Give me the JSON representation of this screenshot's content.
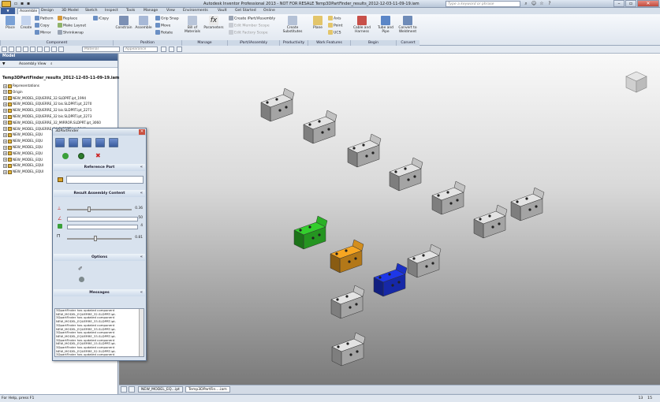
{
  "window": {
    "title": "Autodesk Inventor Professional 2013 - NOT FOR RESALE    Temp3DPartFinder_results_2012-12-03-11-09-19.iam",
    "search_placeholder": "Type a keyword or phrase"
  },
  "tabs": [
    "Assemble",
    "Design",
    "3D Model",
    "Sketch",
    "Inspect",
    "Tools",
    "Manage",
    "View",
    "Environments",
    "Vault",
    "Get Started",
    "Online"
  ],
  "ribbon": {
    "place": "Place",
    "create": "Create",
    "pattern": "Pattern",
    "copy": "Copy",
    "mirror": "Mirror",
    "replace": "Replace",
    "make_layout": "Make Layout",
    "shrinkwrap": "Shrinkwrap",
    "icopy": "iCopy",
    "constrain": "Constrain",
    "assemble": "Assemble",
    "grip_snap": "Grip Snap",
    "move": "Move",
    "rotate": "Rotate",
    "bill_of_materials": "Bill of Materials",
    "parameters": "Parameters",
    "create_ipart": "Create iPart/iAssembly",
    "edit_member_scope": "Edit Member Scope",
    "edit_factory_scope": "Edit Factory Scope",
    "create_substitutes": "Create Substitutes",
    "plane": "Plane",
    "axis": "Axis",
    "point": "Point",
    "ucs": "UCS",
    "cable_harness": "Cable and Harness",
    "tube_pipe": "Tube and Pipe",
    "convert_weldment": "Convert to Weldment",
    "groups": [
      "Component",
      "Position",
      "Manage",
      "iPart/iAssembly",
      "Productivity",
      "Work Features",
      "Begin",
      "Convert"
    ]
  },
  "qat": {
    "material": "Material",
    "appearance": "Appearance"
  },
  "browser": {
    "header": "Model",
    "view": "Assembly View",
    "root": "Temp3DPartFinder_results_2012-12-03-11-09-19.iam",
    "items": [
      "Representations",
      "Origin",
      "NEW_MODEL_EQUERRE_32.SLDPRT.ipt_1994",
      "NEW_MODEL_EQUERRE_32 bis.SLDPRT.ipt_2270",
      "NEW_MODEL_EQUERRE_32 bis.SLDPRT.ipt_2271",
      "NEW_MODEL_EQUERRE_32 bis.SLDPRT.ipt_2273",
      "NEW_MODEL_EQUERRE_32_MIRROR.SLDPRT.ipt_3060",
      "NEW_MODEL_EQUERRE_34.SLDPRT.ipt_1840",
      "NEW_MODEL_EQU",
      "NEW_MODEL_EQU",
      "NEW_MODEL_EQU",
      "NEW_MODEL_EQU",
      "NEW_MODEL_EQU",
      "NEW_MODEL_EQUI",
      "NEW_MODEL_EQUI"
    ]
  },
  "dialog": {
    "title": "3DPartFinder",
    "reference_part": "Reference Part",
    "result_assembly": "Result Assembly Content",
    "options": "Options",
    "messages_title": "Messages",
    "val1": "0.36",
    "val2": "50",
    "val3": "4",
    "val4": "0.81",
    "messages": [
      "3DpartFinder has updated component",
      "NEW_MODEL_EQUERRE_32.SLDPRT.ipt.",
      "3DpartFinder has updated component",
      "NEW_MODEL_EQUERRE_33.SLDPRT.ipt.",
      "3DpartFinder has updated component",
      "NEW_MODEL_EQUERRE_33.SLDPRT.ipt.",
      "3DpartFinder has updated component",
      "NEW_MODEL_EQUERRE_33.SLDPRT.ipt.",
      "3DpartFinder has updated component",
      "NEW_MODEL_EQUERRE_15.SLDPRT.ipt.",
      "3DpartFinder has updated component",
      "NEW_MODEL_EQUERRE_52.5LDPRT.ipt.",
      "3DpartFinder has updated component",
      "NEW_MODEL_EQUERRE_53.56 SLDPRT.ipt.",
      "3DpartFinder has updated component"
    ]
  },
  "doctabs": [
    "NEW_MODEL_EQ...ipt",
    "Temp3DPartFin....iam"
  ],
  "status": {
    "text": "For Help, press F1",
    "num1": "13",
    "num2": "15"
  },
  "colors": {
    "green": "#2fbf2a",
    "orange": "#e59a1f",
    "blue": "#1c33d6",
    "part_grey": "#d2d2d2"
  }
}
